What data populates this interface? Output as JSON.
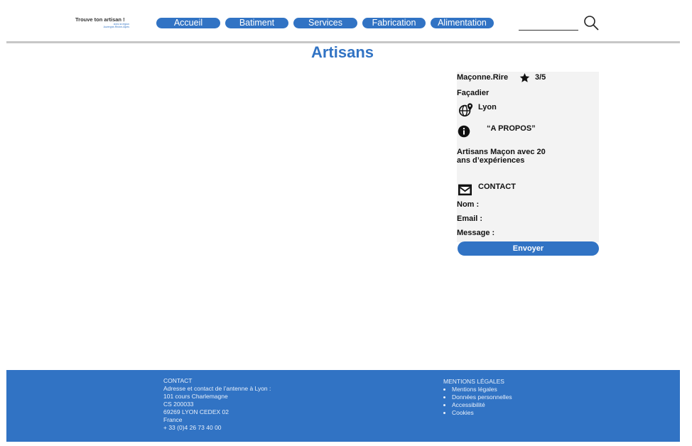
{
  "header": {
    "logo": {
      "title": "Trouve ton artisan !",
      "sub1": "Avec la région",
      "sub2": "Auvergne-Rhône-Alpes"
    },
    "nav": [
      "Accueil",
      "Batiment",
      "Services",
      "Fabrication",
      "Alimentation"
    ]
  },
  "page": {
    "title": "Artisans"
  },
  "card": {
    "name": "Maçonne.Rire",
    "rating": "3/5",
    "specialty": "Façadier",
    "city": "Lyon",
    "about_heading": "“A PROPOS”",
    "about_text_line1": "Artisans Maçon avec  20",
    "about_text_line2": "ans d’expériences",
    "contact_heading": "CONTACT",
    "fields": {
      "name": "Nom :",
      "email": "Email :",
      "message": "Message :"
    },
    "send_label": "Envoyer"
  },
  "footer": {
    "contact": {
      "heading": "CONTACT",
      "lines": [
        "Adresse et contact de l’antenne à Lyon :",
        "101 cours Charlemagne",
        "CS 200033",
        "69269 LYON CEDEX 02",
        "France",
        "+ 33 (0)4 26 73 40 00"
      ]
    },
    "legal": {
      "heading": "MENTIONS LÉGALES",
      "items": [
        "Mentions légales",
        "Données personnelles",
        "Accessibilité",
        "Cookies"
      ]
    }
  },
  "colors": {
    "primary": "#3173c4",
    "card_bg": "#f3f3f3",
    "separator": "#c7c7c7"
  }
}
